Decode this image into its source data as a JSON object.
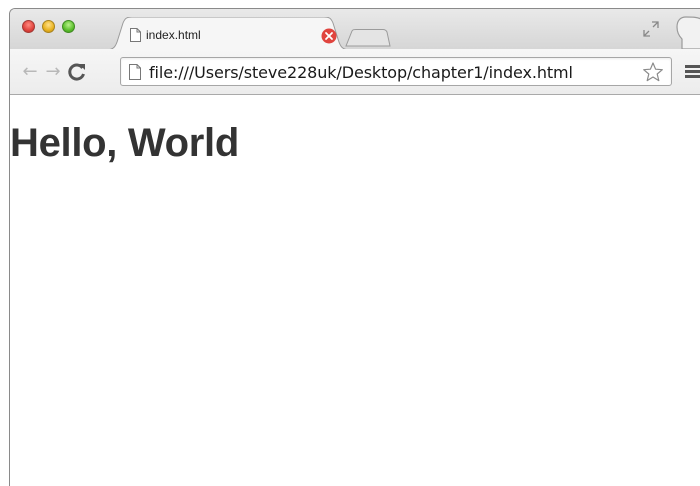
{
  "browser": {
    "tab": {
      "title": "index.html"
    },
    "address_bar": {
      "url": "file:///Users/steve228uk/Desktop/chapter1/index.html"
    },
    "nav": {
      "back": "←",
      "forward": "→",
      "reload": "C"
    }
  },
  "page": {
    "heading": "Hello, World"
  },
  "colors": {
    "heading_text": "#333333",
    "tab_close_red": "#e0443e"
  },
  "icons": [
    "close-window-icon",
    "minimize-window-icon",
    "maximize-window-icon",
    "page-icon",
    "tab-close-icon",
    "new-tab-icon",
    "fullscreen-icon",
    "profile-icon",
    "back-arrow-icon",
    "forward-arrow-icon",
    "reload-icon",
    "bookmark-star-icon",
    "menu-icon"
  ]
}
